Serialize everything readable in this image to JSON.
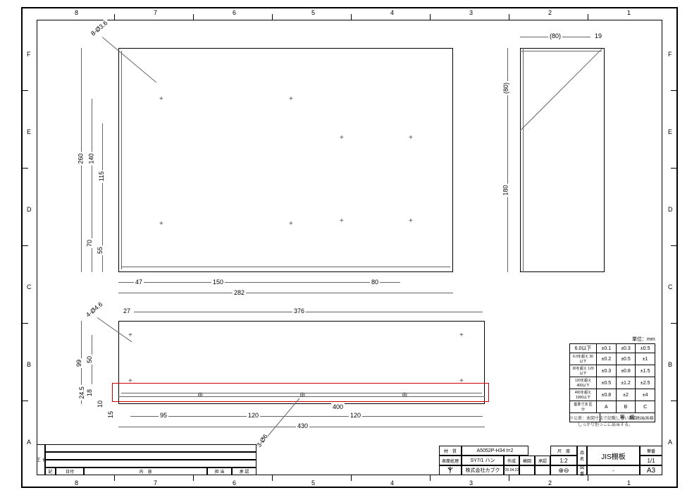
{
  "grid": {
    "cols": [
      "8",
      "7",
      "6",
      "5",
      "4",
      "3",
      "2",
      "1"
    ],
    "rows": [
      "F",
      "E",
      "D",
      "C",
      "B",
      "A"
    ]
  },
  "top_view": {
    "hole_callout": "8-Ø3.6",
    "dims_v": {
      "d1": "260",
      "d2": "140",
      "d3": "115",
      "d4": "70",
      "d5": "55"
    },
    "dims_h": {
      "d1": "47",
      "d2": "150",
      "d3": "282",
      "d4": "80"
    }
  },
  "side_view": {
    "dims": {
      "w": "(80)",
      "t": "19",
      "h": "180",
      "h2": "(80)"
    }
  },
  "front_view": {
    "hole_callout": "4-Ø4.6",
    "hole_callout2": "3-Ø6",
    "dims_v": {
      "d1": "99",
      "d2": "50",
      "d3": "24.5",
      "d4": "18",
      "d5": "10",
      "d6": "15"
    },
    "dims_h": {
      "d0": "27",
      "d1": "376",
      "d2": "95",
      "d3": "120",
      "d4": "120",
      "d5": "400",
      "d6": "430"
    }
  },
  "tolerance": {
    "unit_label": "単位：mm",
    "rows": [
      {
        "r": "6.0以下",
        "a": "±0.1",
        "b": "±0.3",
        "c": "±0.5"
      },
      {
        "r": "6.0を超え\n30以下",
        "a": "±0.2",
        "b": "±0.5",
        "c": "±1"
      },
      {
        "r": "30を超え\n120以下",
        "a": "±0.3",
        "b": "±0.8",
        "c": "±1.5"
      },
      {
        "r": "120を超え\n400以下",
        "a": "±0.5",
        "b": "±1.2",
        "c": "±2.5"
      },
      {
        "r": "400を超え\n1000以下",
        "a": "±0.8",
        "b": "±2",
        "c": "±4"
      }
    ],
    "footer": {
      "l": "基準寸法\n区分",
      "a": "A",
      "b": "B",
      "c": "C",
      "grade": "等　級"
    }
  },
  "notes": {
    "n1": "※公差：本図寸法で記載しない場合もしくは\n　　しっかり別っこに該当する。",
    "n2": "JIS B 0405の"
  },
  "title_block": {
    "material_l": "材　質",
    "material": "A5052P-H34 t=2",
    "surface_l": "表面処理",
    "surface": "SY7/1 ハン",
    "scale_l": "尺　度",
    "scale": "1:2",
    "name_l": "品\n名",
    "name": "JIS棚板",
    "sheet_l": "葉番",
    "sheet": "1/1",
    "dwg_l": "図\n番",
    "dwg": "-",
    "size": "A3",
    "company": "株式会社カブク",
    "date": "'20.04.22",
    "creator_l": "作成",
    "checker_l": "検図",
    "approver_l": "承認",
    "proj": "⊕⊖"
  },
  "rev_block": {
    "h1": "記",
    "h2": "日付",
    "h3": "内　容",
    "h4": "担 当",
    "h5": "承 認",
    "side": "修\n正"
  }
}
